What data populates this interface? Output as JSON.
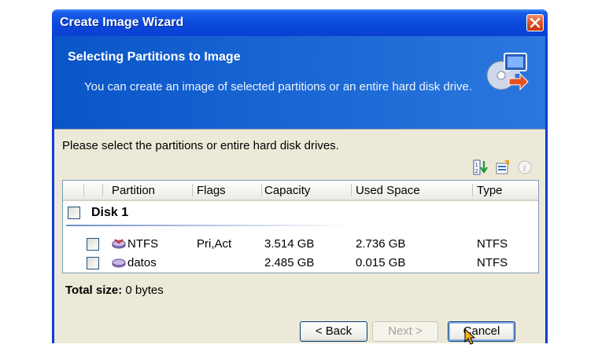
{
  "window": {
    "title": "Create Image Wizard"
  },
  "header": {
    "title": "Selecting Partitions to Image",
    "description": "You can create an image of selected partitions or an entire hard disk drive."
  },
  "prompt": "Please select the partitions or entire hard disk drives.",
  "toolbar": {
    "icons": [
      "sort-icon",
      "properties-icon",
      "info-icon"
    ]
  },
  "table": {
    "columns": [
      "Partition",
      "Flags",
      "Capacity",
      "Used Space",
      "Type"
    ],
    "disk": {
      "label": "Disk 1",
      "checked": false
    },
    "rows": [
      {
        "partition": "NTFS",
        "flags": "Pri,Act",
        "capacity": "3.514 GB",
        "used": "2.736 GB",
        "type": "NTFS"
      },
      {
        "partition": "datos",
        "flags": "",
        "capacity": "2.485 GB",
        "used": "0.015 GB",
        "type": "NTFS"
      }
    ]
  },
  "total": {
    "label": "Total size:",
    "value": "0 bytes"
  },
  "buttons": {
    "back": "< Back",
    "next": "Next >",
    "cancel": "Cancel"
  },
  "colors": {
    "titlebar": "#0a48dc",
    "header": "#1d6ad6",
    "dialog_bg": "#ece9d8",
    "close": "#d84a20"
  }
}
